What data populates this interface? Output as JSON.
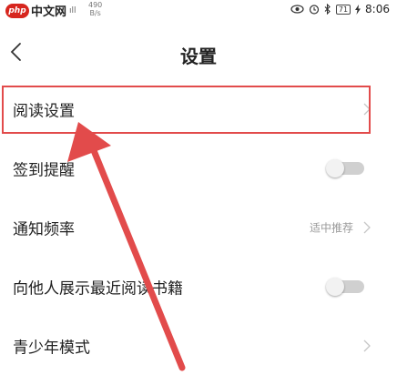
{
  "status_bar": {
    "watermark_badge": "php",
    "watermark_text": "中文网",
    "signal": "ıll",
    "net_speed_value": "490",
    "net_speed_unit": "B/s",
    "battery": "71",
    "time": "8:06"
  },
  "header": {
    "title": "设置"
  },
  "settings": [
    {
      "label": "阅读设置",
      "type": "link",
      "value": "",
      "highlighted": true
    },
    {
      "label": "签到提醒",
      "type": "toggle",
      "value": "",
      "on": false
    },
    {
      "label": "通知频率",
      "type": "link",
      "value": "适中推荐"
    },
    {
      "label": "向他人展示最近阅读书籍",
      "type": "toggle",
      "value": "",
      "on": false
    },
    {
      "label": "青少年模式",
      "type": "link",
      "value": ""
    }
  ],
  "colors": {
    "annotation": "#e24b4b",
    "toggle_off_track": "#d0d0d0",
    "secondary_text": "#9a9a9a"
  }
}
